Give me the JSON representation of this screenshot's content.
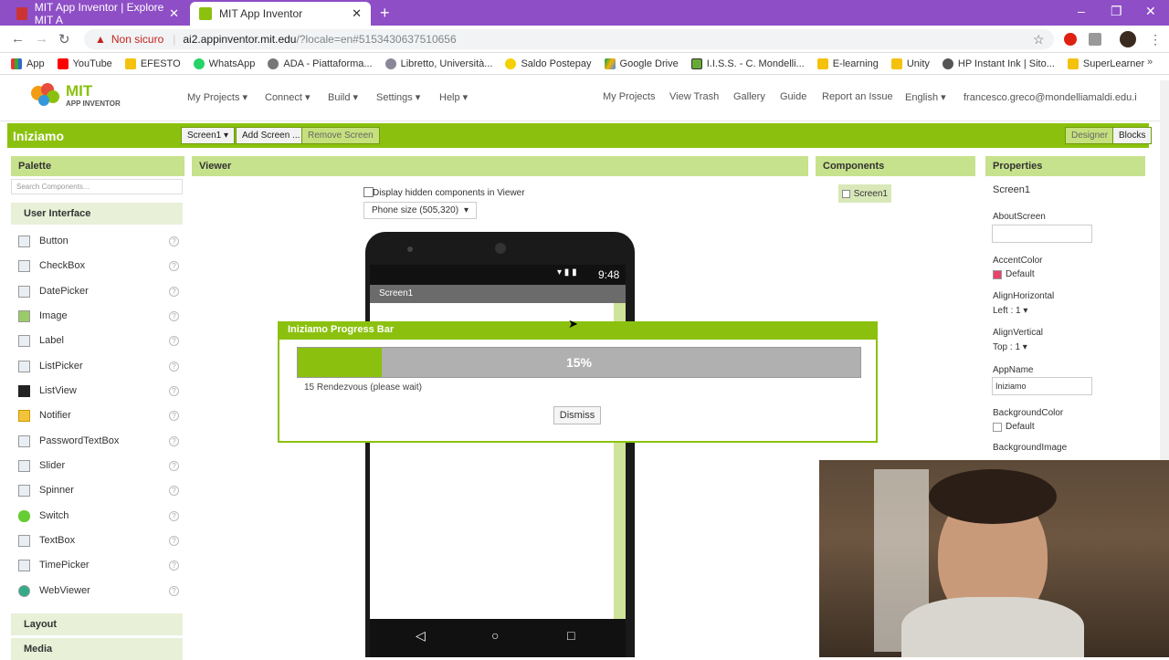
{
  "browser": {
    "tabs": [
      {
        "title": "MIT App Inventor | Explore MIT A",
        "active": false
      },
      {
        "title": "MIT App Inventor",
        "active": true
      }
    ],
    "security": "Non sicuro",
    "url_host": "ai2.appinventor.mit.edu",
    "url_path": "/?locale=en#5153430637510656",
    "bookmarks": [
      "App",
      "YouTube",
      "EFESTO",
      "WhatsApp",
      "ADA - Piattaforma...",
      "Libretto, Università...",
      "Saldo Postepay",
      "Google Drive",
      "I.I.S.S. - C. Mondelli...",
      "E-learning",
      "Unity",
      "HP Instant Ink | Sito...",
      "SuperLearner"
    ]
  },
  "app": {
    "logo_top": "MIT",
    "logo_bottom": "APP INVENTOR",
    "menus_left": [
      "My Projects ▾",
      "Connect ▾",
      "Build ▾",
      "Settings ▾",
      "Help ▾"
    ],
    "menus_right": [
      "My Projects",
      "View Trash",
      "Gallery",
      "Guide",
      "Report an Issue",
      "English ▾",
      "francesco.greco@mondelliamaldi.edu.it ▾"
    ],
    "project_name": "Iniziamo",
    "screen_dropdown": "Screen1 ▾",
    "add_screen": "Add Screen ...",
    "remove_screen": "Remove Screen",
    "designer": "Designer",
    "blocks": "Blocks"
  },
  "palette": {
    "title": "Palette",
    "search_placeholder": "Search Components...",
    "section": "User Interface",
    "items": [
      "Button",
      "CheckBox",
      "DatePicker",
      "Image",
      "Label",
      "ListPicker",
      "ListView",
      "Notifier",
      "PasswordTextBox",
      "Slider",
      "Spinner",
      "Switch",
      "TextBox",
      "TimePicker",
      "WebViewer"
    ],
    "more_sections": [
      "Layout",
      "Media"
    ]
  },
  "viewer": {
    "title": "Viewer",
    "hidden_checkbox": "Display hidden components in Viewer",
    "size_select": "Phone size (505,320)",
    "status_time": "9:48",
    "screen_title": "Screen1"
  },
  "dialog": {
    "title": "Iniziamo Progress Bar",
    "progress": 15,
    "progress_label": "15%",
    "message": "15 Rendezvous (please wait)",
    "dismiss": "Dismiss"
  },
  "components": {
    "title": "Components",
    "tree_root": "Screen1"
  },
  "properties": {
    "title": "Properties",
    "component": "Screen1",
    "about_label": "AboutScreen",
    "accent_label": "AccentColor",
    "accent_value": "Default",
    "align_h_label": "AlignHorizontal",
    "align_h_value": "Left : 1 ▾",
    "align_v_label": "AlignVertical",
    "align_v_value": "Top : 1 ▾",
    "appname_label": "AppName",
    "appname_value": "Iniziamo",
    "bgcolor_label": "BackgroundColor",
    "bgcolor_value": "Default",
    "bgimage_label": "BackgroundImage"
  },
  "colors": {
    "accent": "#8bc10e",
    "chrome": "#8e4ec6",
    "accent_swatch": "#e8436b"
  }
}
